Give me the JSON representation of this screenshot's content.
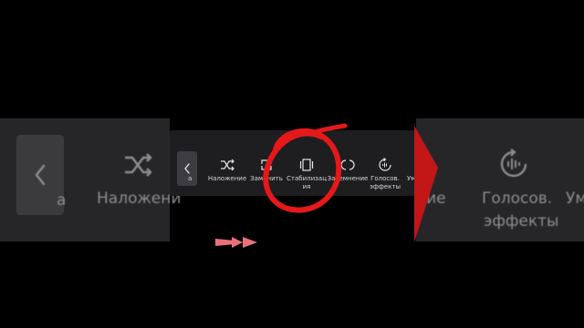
{
  "toolbar": {
    "items": [
      {
        "label": "Наложение",
        "icon": "shuffle-icon"
      },
      {
        "label": "Заменить",
        "icon": "replace-icon"
      },
      {
        "label": "Стабилизац\nия",
        "icon": "stabilization-icon"
      },
      {
        "label": "Затемнение",
        "icon": "fade-icon"
      },
      {
        "label": "Голосов.\nэффекты",
        "icon": "voice-effects-icon"
      },
      {
        "label": "Ум",
        "icon": "cut-off-icon"
      }
    ],
    "back_icon": "chevron-left-icon"
  },
  "background": {
    "left_label": "Наложени",
    "right_label_1": "ние",
    "right_label_2": "Голосов.",
    "right_label_3": "эффекты",
    "right_label_4": "Ум",
    "left_fragment": "а"
  },
  "annotation": {
    "circle_color": "#e5181a",
    "arrow_color": "#e8727a"
  }
}
